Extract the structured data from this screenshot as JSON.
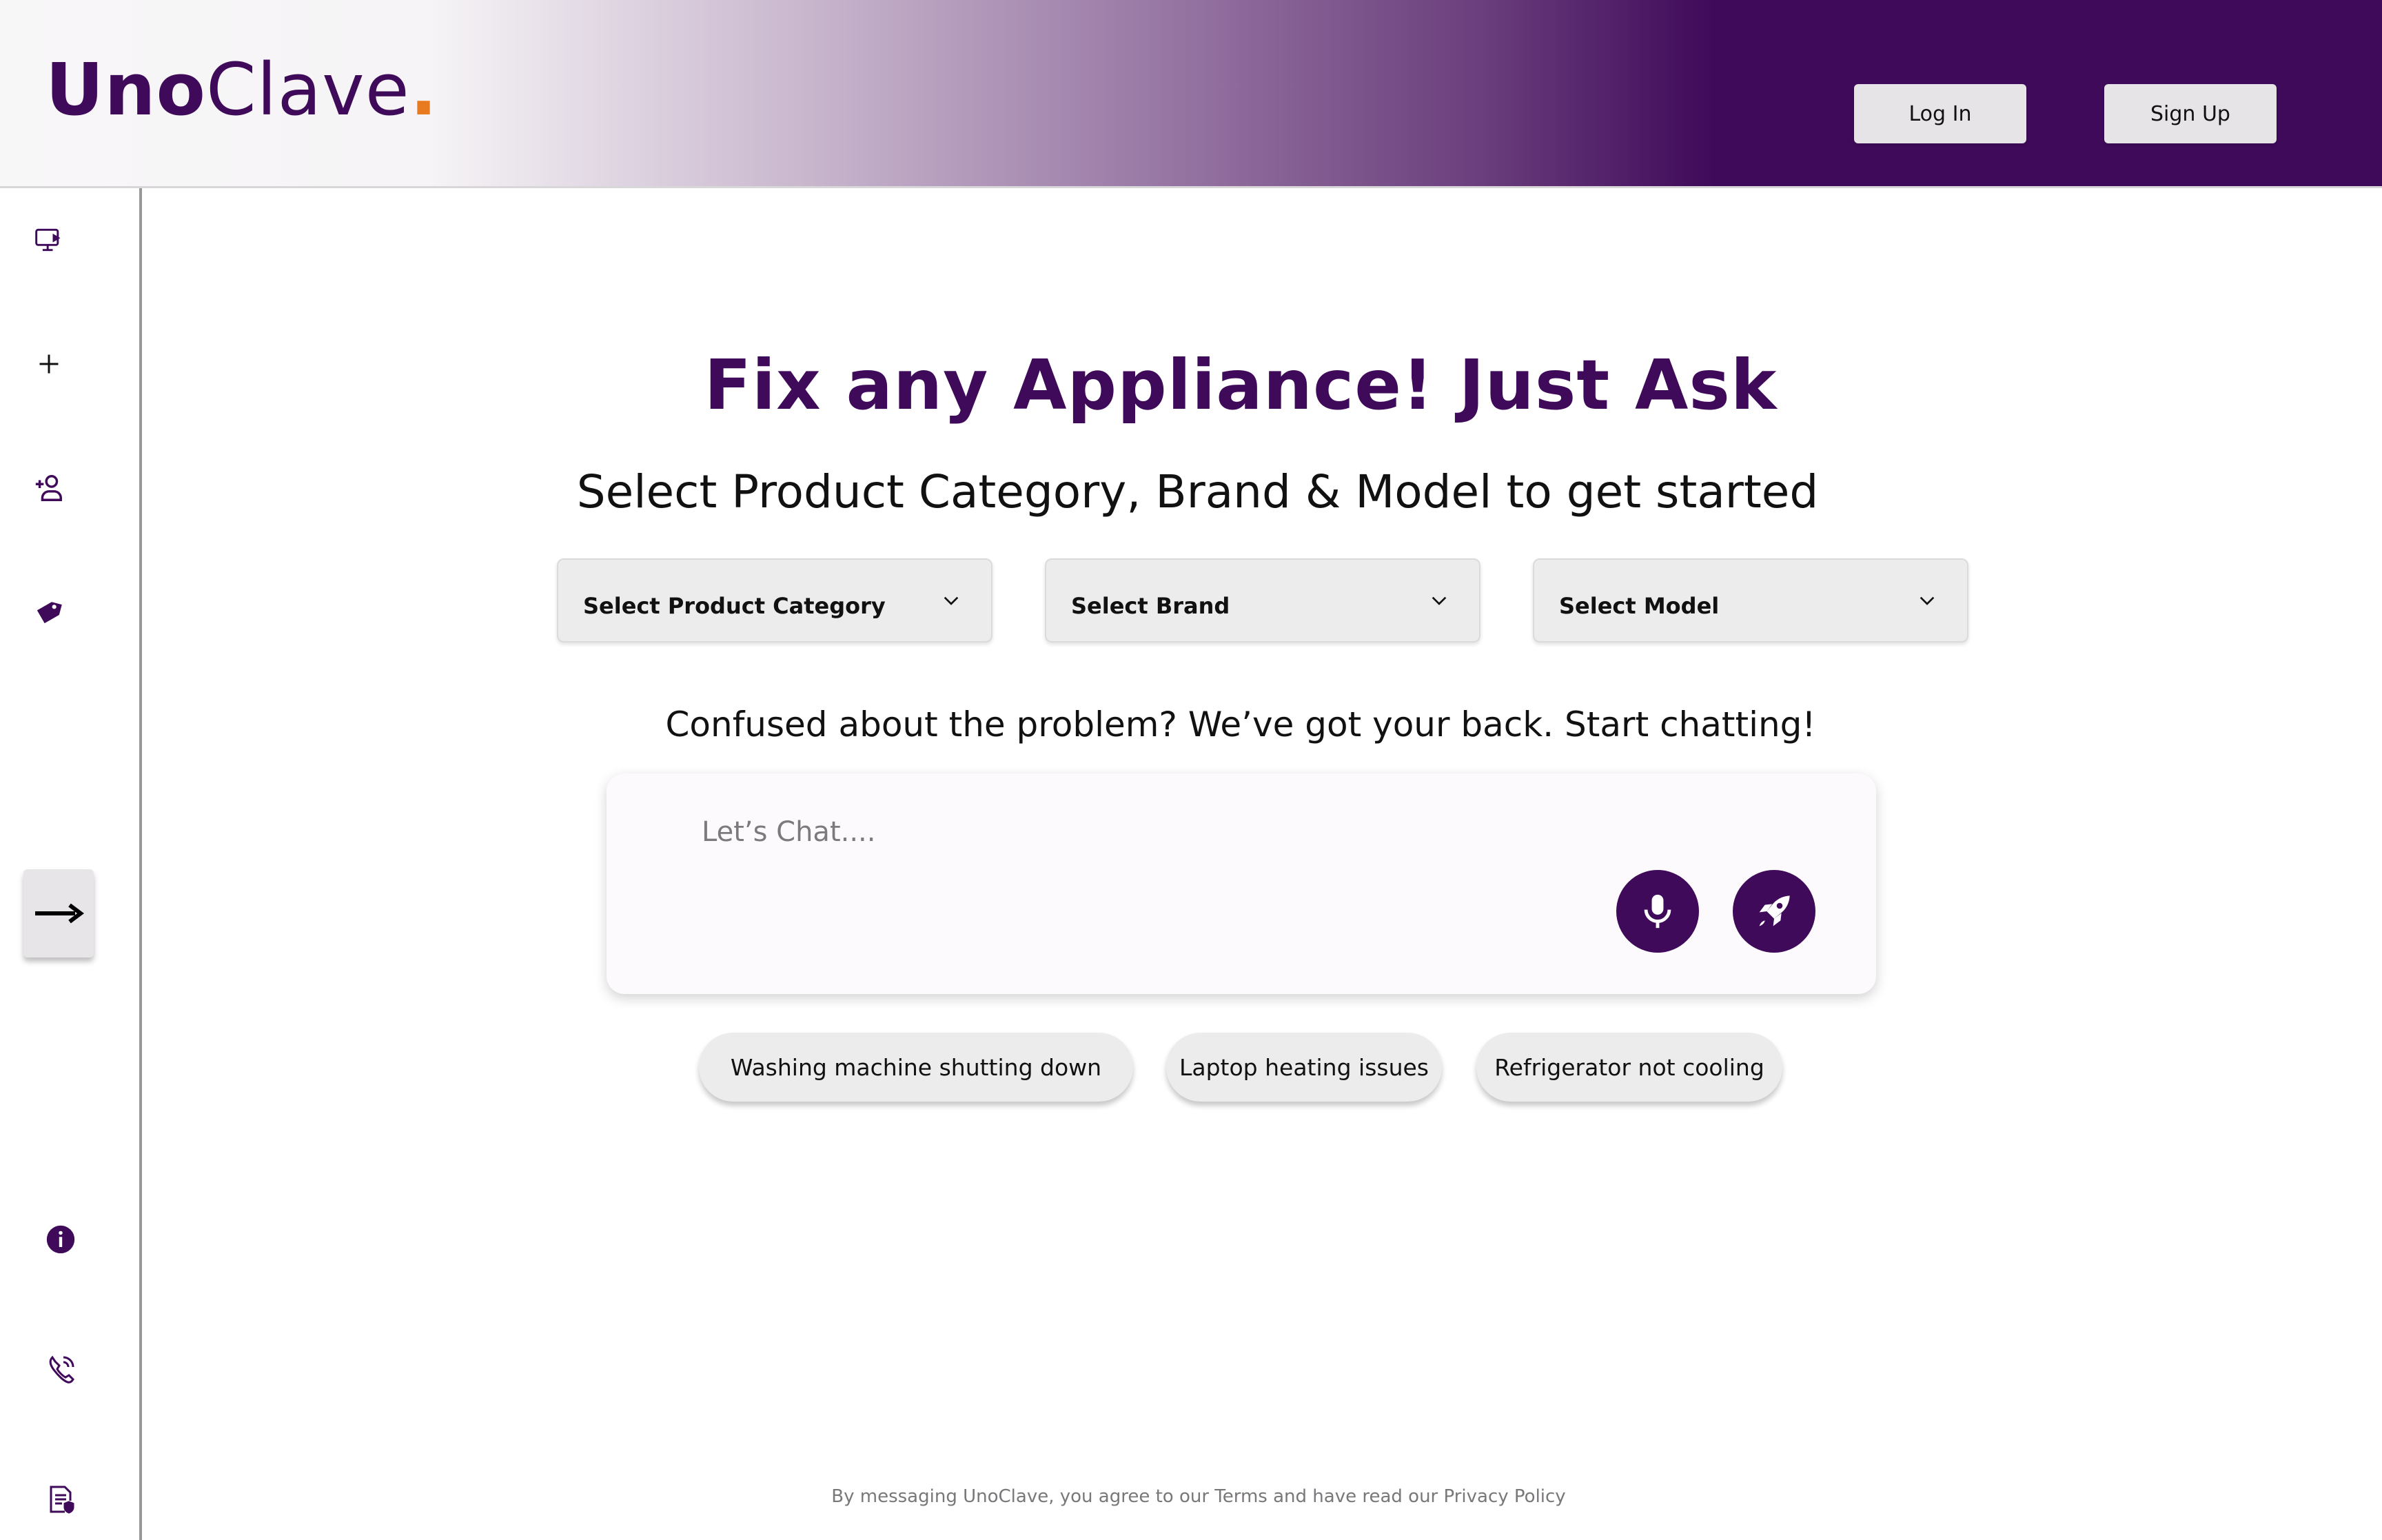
{
  "brand": {
    "name_bold": "Uno",
    "name_thin": "Clave",
    "dot": ".",
    "primary_color": "#3f0a5a",
    "accent_color": "#e87a1f"
  },
  "header": {
    "login_label": "Log In",
    "signup_label": "Sign Up"
  },
  "sidebar": {
    "items": [
      {
        "icon": "monitor-play-icon"
      },
      {
        "icon": "plus-icon"
      },
      {
        "icon": "add-user-icon"
      },
      {
        "icon": "tag-icon"
      },
      {
        "icon": "arrow-right-icon"
      },
      {
        "icon": "info-icon"
      },
      {
        "icon": "phone-icon"
      },
      {
        "icon": "document-shield-icon"
      }
    ]
  },
  "main": {
    "headline": "Fix any Appliance! Just Ask",
    "subheadline": "Select Product Category, Brand & Model to get started",
    "selects": [
      {
        "label": "Select Product Category"
      },
      {
        "label": "Select Brand"
      },
      {
        "label": "Select Model"
      }
    ],
    "confused_text": "Confused about the problem? We’ve got your back. Start chatting!",
    "chat": {
      "placeholder": "Let’s Chat....",
      "mic_icon": "microphone-icon",
      "send_icon": "rocket-icon"
    },
    "suggestions": [
      "Washing machine shutting down",
      "Laptop heating issues",
      "Refrigerator not cooling"
    ]
  },
  "footer": {
    "text": "By messaging UnoClave, you agree to our Terms and have read our Privacy Policy"
  }
}
